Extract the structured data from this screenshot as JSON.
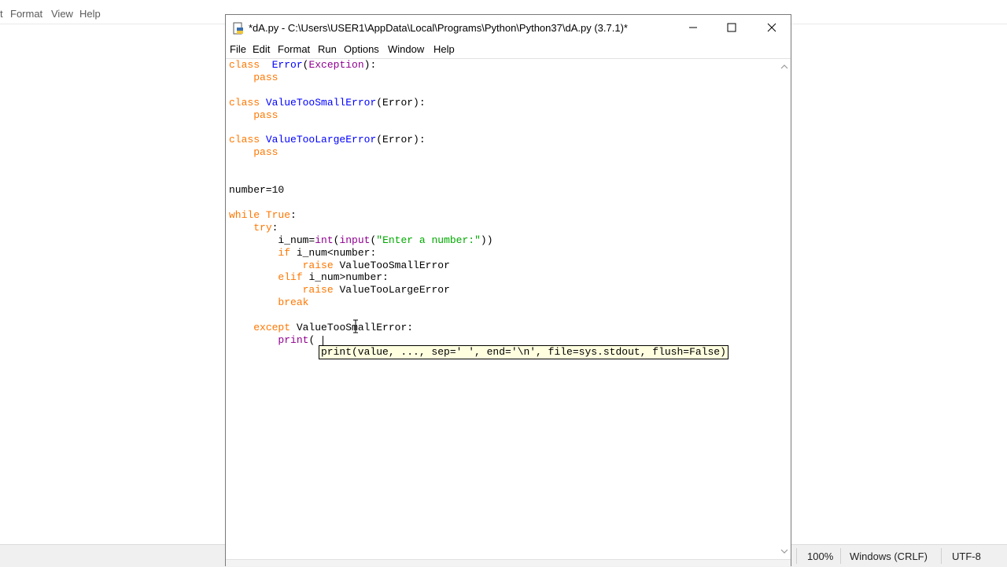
{
  "background_window": {
    "menu": [
      "t",
      "Format",
      "View",
      "Help"
    ],
    "status": {
      "zoom": "100%",
      "line_ending": "Windows (CRLF)",
      "encoding": "UTF-8"
    }
  },
  "idle": {
    "title": "*dA.py - C:\\Users\\USER1\\AppData\\Local\\Programs\\Python\\Python37\\dA.py (3.7.1)*",
    "menu": [
      "File",
      "Edit",
      "Format",
      "Run",
      "Options",
      "Window",
      "Help"
    ],
    "calltip": "print(value, ..., sep=' ', end='\\n', file=sys.stdout, flush=False)",
    "code_lines": [
      [
        [
          "kw",
          "class"
        ],
        [
          "",
          "  "
        ],
        [
          "def",
          "Error"
        ],
        [
          "",
          "("
        ],
        [
          "bi",
          "Exception"
        ],
        [
          "",
          "):"
        ]
      ],
      [
        [
          "",
          "    "
        ],
        [
          "kw",
          "pass"
        ]
      ],
      [],
      [
        [
          "kw",
          "class"
        ],
        [
          "",
          ""
        ],
        [
          "def",
          " ValueTooSmallError"
        ],
        [
          "",
          "(Error):"
        ]
      ],
      [
        [
          "",
          "    "
        ],
        [
          "kw",
          "pass"
        ]
      ],
      [],
      [
        [
          "kw",
          "class"
        ],
        [
          "def",
          " ValueTooLargeError"
        ],
        [
          "",
          "(Error):"
        ]
      ],
      [
        [
          "",
          "    "
        ],
        [
          "kw",
          "pass"
        ]
      ],
      [],
      [],
      [
        [
          "",
          "number=10"
        ]
      ],
      [],
      [
        [
          "kw",
          "while"
        ],
        [
          "",
          " "
        ],
        [
          "kw",
          "True"
        ],
        [
          "",
          ":"
        ]
      ],
      [
        [
          "",
          "    "
        ],
        [
          "kw",
          "try"
        ],
        [
          "",
          ":"
        ]
      ],
      [
        [
          "",
          "        i_num="
        ],
        [
          "bi",
          "int"
        ],
        [
          "",
          "("
        ],
        [
          "bi",
          "input"
        ],
        [
          "",
          "("
        ],
        [
          "str",
          "\"Enter a number:\""
        ],
        [
          "",
          "))"
        ]
      ],
      [
        [
          "",
          "        "
        ],
        [
          "kw",
          "if"
        ],
        [
          "",
          " i_num<number:"
        ]
      ],
      [
        [
          "",
          "            "
        ],
        [
          "kw",
          "raise"
        ],
        [
          "",
          " ValueTooSmallError"
        ]
      ],
      [
        [
          "",
          "        "
        ],
        [
          "kw",
          "elif"
        ],
        [
          "",
          " i_num>number:"
        ]
      ],
      [
        [
          "",
          "            "
        ],
        [
          "kw",
          "raise"
        ],
        [
          "",
          " ValueTooLargeError"
        ]
      ],
      [
        [
          "",
          "        "
        ],
        [
          "kw",
          "break"
        ]
      ],
      [],
      [
        [
          "",
          "    "
        ],
        [
          "kw",
          "except"
        ],
        [
          "",
          " ValueTooSmallError:"
        ]
      ],
      [
        [
          "",
          "        "
        ],
        [
          "bi",
          "print"
        ],
        [
          "",
          "("
        ]
      ]
    ]
  }
}
